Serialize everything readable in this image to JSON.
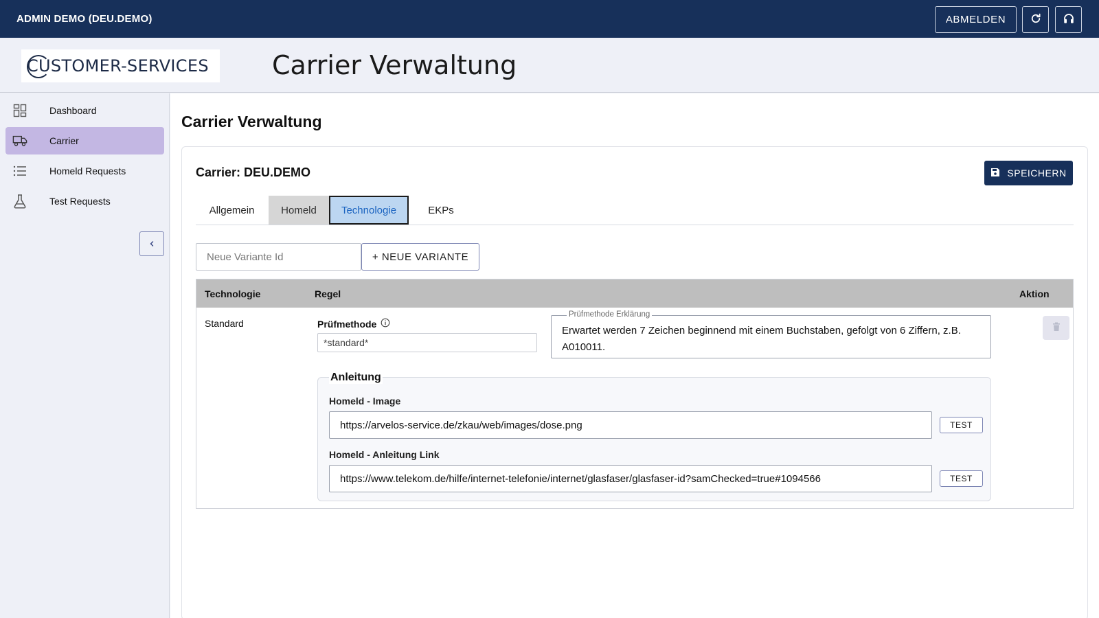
{
  "topbar": {
    "user": "ADMIN DEMO (DEU.DEMO)",
    "logout_label": "ABMELDEN",
    "refresh_icon": "refresh-icon",
    "support_icon": "headset-icon"
  },
  "header": {
    "logo_text": "CUSTOMER-SERVICES",
    "app_title": "Carrier Verwaltung"
  },
  "sidebar": {
    "items": [
      {
        "label": "Dashboard",
        "icon": "dashboard-icon",
        "active": false
      },
      {
        "label": "Carrier",
        "icon": "truck-icon",
        "active": true
      },
      {
        "label": "Homeld Requests",
        "icon": "list-icon",
        "active": false
      },
      {
        "label": "Test Requests",
        "icon": "flask-icon",
        "active": false
      }
    ],
    "collapse_icon": "chevron-left-icon"
  },
  "main": {
    "page_title": "Carrier Verwaltung",
    "carrier_title": "Carrier: DEU.DEMO",
    "save_label": "SPEICHERN",
    "tabs": [
      {
        "label": "Allgemein"
      },
      {
        "label": "Homeld"
      },
      {
        "label": "Technologie",
        "active": true
      },
      {
        "label": "EKPs"
      }
    ],
    "variant_input_placeholder": "Neue Variante Id",
    "new_variant_label": "+ NEUE VARIANTE",
    "table": {
      "columns": [
        "Technologie",
        "Regel",
        "Aktion"
      ],
      "rows": [
        {
          "technologie": "Standard",
          "pruefmethode_label": "Prüfmethode",
          "pruefmethode_value": "*standard*",
          "erklaerung_legend": "Prüfmethode Erklärung",
          "erklaerung_text": "Erwartet werden 7 Zeichen beginnend mit einem Buchstaben, gefolgt von 6 Ziffern, z.B. A010011.",
          "anleitung": {
            "title": "Anleitung",
            "image_label": "Homeld - Image",
            "image_value": "https://arvelos-service.de/zkau/web/images/dose.png",
            "link_label": "Homeld - Anleitung Link",
            "link_value": "https://www.telekom.de/hilfe/internet-telefonie/internet/glasfaser/glasfaser-id?samChecked=true#1094566",
            "test_label": "TEST"
          }
        }
      ]
    }
  },
  "colors": {
    "topbar": "#17305a",
    "active_nav": "#c3b7e3",
    "active_tab_bg": "#bcd6f1",
    "active_tab_text": "#1a63c0",
    "table_header": "#bebebe"
  }
}
